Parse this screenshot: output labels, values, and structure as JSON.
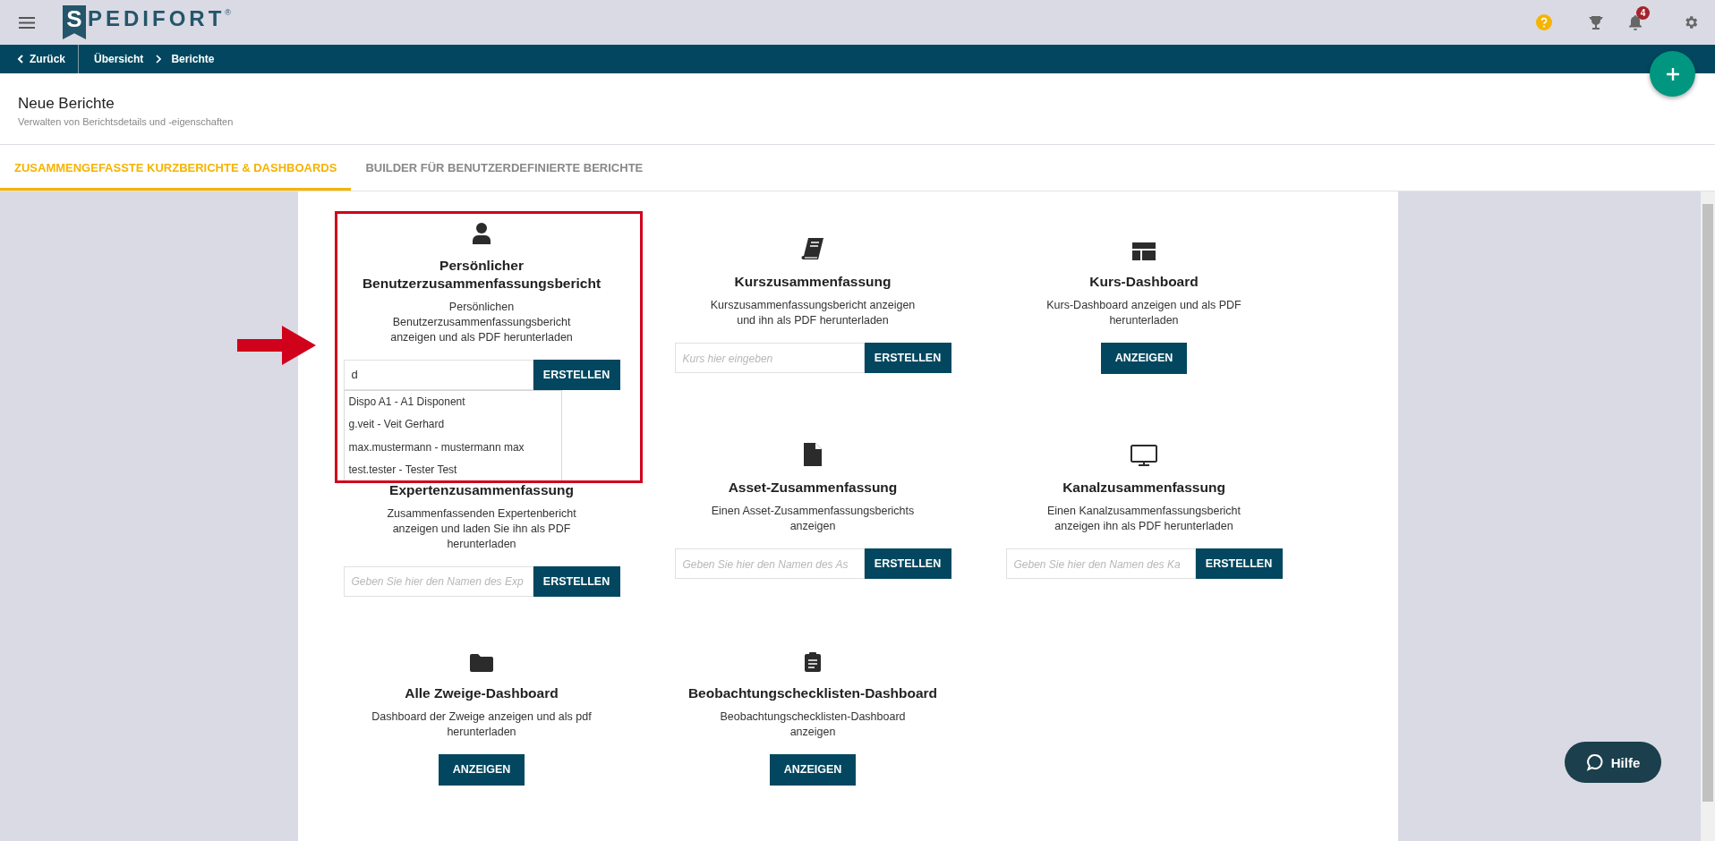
{
  "top_bar": {
    "logo": {
      "first": "S",
      "rest": "PEDIFORT",
      "mark": "®"
    },
    "notification_count": "4"
  },
  "breadcrumb": {
    "back": "Zurück",
    "items": [
      "Übersicht",
      "Berichte"
    ]
  },
  "header": {
    "title": "Neue Berichte",
    "subtitle": "Verwalten von Berichtsdetails und -eigenschaften"
  },
  "tabs": [
    {
      "label": "ZUSAMMENGEFASSTE KURZBERICHTE & DASHBOARDS",
      "selected": true
    },
    {
      "label": "BUILDER FÜR BENUTZERDEFINIERTE BERICHTE",
      "selected": false
    }
  ],
  "cards": [
    {
      "title": "Persönlicher Benutzerzusammenfassungsbericht",
      "description": "Persönlichen Benutzerzusammenfassungsbericht anzeigen und als PDF herunterladen",
      "kind": "input",
      "value": "d",
      "button": "ERSTELLEN",
      "suggestions": [
        "Dispo A1 - A1 Disponent",
        "g.veit - Veit Gerhard",
        "max.mustermann - mustermann max",
        "test.tester - Tester Test"
      ]
    },
    {
      "title": "Kurszusammenfassung",
      "description": "Kurszusammenfassungsbericht anzeigen und ihn als PDF herunterladen",
      "kind": "input",
      "placeholder": "Kurs hier eingeben",
      "button": "ERSTELLEN"
    },
    {
      "title": "Kurs-Dashboard",
      "description": "Kurs-Dashboard anzeigen und als PDF herunterladen",
      "kind": "view",
      "button": "ANZEIGEN"
    },
    {
      "title": "Expertenzusammenfassung",
      "description": "Zusammenfassenden Expertenbericht anzeigen und laden Sie ihn als PDF herunterladen",
      "kind": "input",
      "placeholder": "Geben Sie hier den Namen des Exp",
      "button": "ERSTELLEN"
    },
    {
      "title": "Asset-Zusammenfassung",
      "description": "Einen Asset-Zusammenfassungsberichts anzeigen",
      "kind": "input",
      "placeholder": "Geben Sie hier den Namen des As",
      "button": "ERSTELLEN"
    },
    {
      "title": "Kanalzusammenfassung",
      "description": "Einen Kanalzusammenfassungsbericht anzeigen ihn als PDF herunterladen",
      "kind": "input",
      "placeholder": "Geben Sie hier den Namen des Ka",
      "button": "ERSTELLEN"
    },
    {
      "title": "Alle Zweige-Dashboard",
      "description": "Dashboard der Zweige anzeigen und als pdf herunterladen",
      "kind": "view",
      "button": "ANZEIGEN"
    },
    {
      "title": "Beobachtungschecklisten-Dashboard",
      "description": "Beobachtungschecklisten-Dashboard anzeigen",
      "kind": "view",
      "button": "ANZEIGEN"
    }
  ],
  "help_button": "Hilfe"
}
